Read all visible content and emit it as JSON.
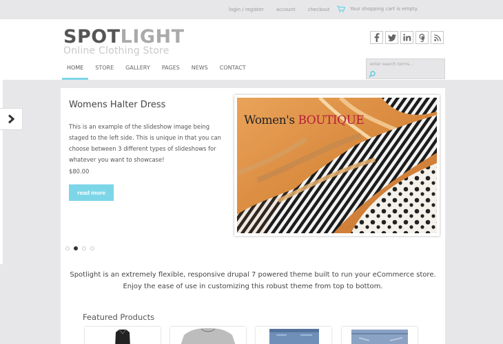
{
  "top_links": [
    "login / register",
    "account",
    "checkout"
  ],
  "cart": {
    "text": "Your shopping cart is empty.",
    "icon": "cart-icon",
    "color": "#7dd6e8"
  },
  "logo": {
    "part1": "SPOT",
    "part2": "LIGHT",
    "tagline": "Online Clothing Store"
  },
  "social": [
    {
      "name": "facebook-icon",
      "glyph": "f"
    },
    {
      "name": "twitter-icon",
      "glyph": "t"
    },
    {
      "name": "linkedin-icon",
      "glyph": "in"
    },
    {
      "name": "google-icon",
      "glyph": "g"
    },
    {
      "name": "rss-icon",
      "glyph": "rss"
    }
  ],
  "nav": [
    "HOME",
    "STORE",
    "GALLERY",
    "PAGES",
    "NEWS",
    "CONTACT"
  ],
  "search": {
    "placeholder": "enter search terms..."
  },
  "slide": {
    "title": "Womens Halter Dress",
    "description": "This is an example of the slideshow image being staged to the left side. This is unique in that you can choose between 3 different types of slideshows for whatever you want to showcase!",
    "price": "$80.00",
    "button": "read more",
    "image_text_1": "Women's ",
    "image_text_2": "BOUTIQUE"
  },
  "blurb": {
    "line1": "Spotlight is an extremely flexible, responsive drupal 7 powered theme built to run your eCommerce store.",
    "line2": "Enjoy the ease of use in customizing this robust theme from top to bottom."
  },
  "featured_title": "Featured Products",
  "accent_color": "#7dd6e8"
}
